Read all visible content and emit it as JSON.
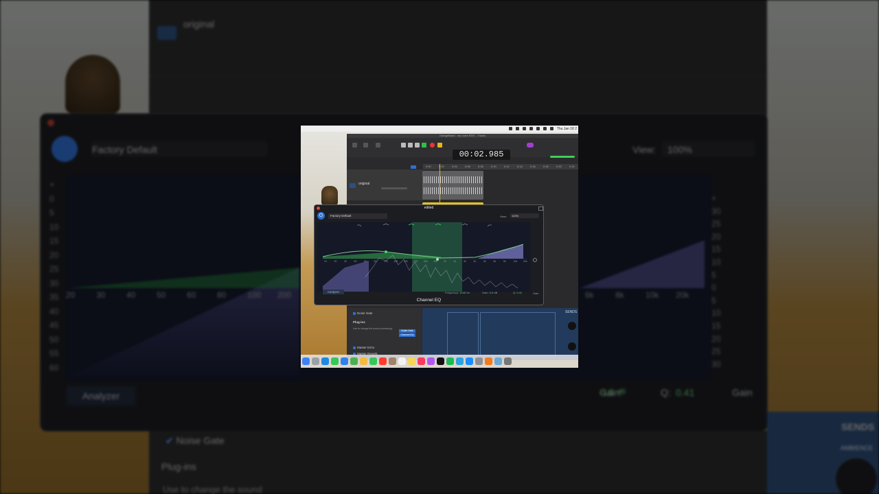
{
  "background": {
    "track_name": "original",
    "preset": "Factory Default",
    "view_label": "View:",
    "view_value": "100%",
    "analyzer": "Analyzer",
    "noise_gate": "Noise Gate",
    "plugins": "Plug-ins",
    "plugins_desc": "Use to change the sound",
    "sends": "SENDS",
    "ambience": "AMBIENCE",
    "gain_label": "Gain:",
    "gain_value": "0.0",
    "gain_unit": "dB",
    "q_label": "Q:",
    "q_value": "0.41",
    "gain_right": "Gain",
    "db_scale": [
      "+",
      "0",
      "5",
      "10",
      "15",
      "20",
      "25",
      "30",
      "35",
      "40",
      "45",
      "50",
      "55",
      "60"
    ],
    "db_scale_right": [
      "+",
      "30",
      "25",
      "20",
      "15",
      "10",
      "5",
      "0",
      "5",
      "10",
      "15",
      "20",
      "25",
      "30"
    ],
    "freq_left": [
      "20",
      "30",
      "40",
      "50",
      "60",
      "80",
      "100",
      "200"
    ],
    "freq_right": [
      "6k",
      "8k",
      "10k",
      "20k"
    ]
  },
  "window": {
    "title": "GarageBand - my voice EDIT - Tracks",
    "time": "00:02.985",
    "ruler": [
      "0:00",
      "0:02",
      "0:04",
      "0:06",
      "0:08",
      "0:10",
      "0:12",
      "0:14",
      "0:16",
      "0:18",
      "0:20",
      "0:22"
    ],
    "track_name": "original",
    "sends": "SENDS"
  },
  "eq": {
    "title": "edited",
    "preset": "Factory Default",
    "view_label": "View:",
    "view_value": "100%",
    "analyzer_button": "Analyzer",
    "frequency_label": "Frequency:",
    "frequency_value": "1040",
    "frequency_unit": "Hz",
    "gain_label": "Gain:",
    "gain_value": "0.0",
    "gain_unit": "dB",
    "q_label": "Q:",
    "q_value": "0.41",
    "gain_right": "Gain",
    "plugin_name": "Channel EQ",
    "freq_ticks": [
      "20",
      "30",
      "40",
      "50",
      "60",
      "80",
      "100",
      "200",
      "300",
      "400",
      "500",
      "800",
      "1k",
      "2k",
      "3k",
      "4k",
      "5k",
      "6k",
      "8k",
      "10k",
      "20k"
    ]
  },
  "library": {
    "noise_gate": "Noise Gate",
    "plugins": "Plug-ins",
    "plugins_desc": "Use to change the sound processing.",
    "plugin_slots": [
      "Noise Gate",
      "Channel EQ"
    ],
    "master_echo": "Master Echo",
    "master_reverb": "Master Reverb"
  },
  "menubar": {
    "clock": "Thu Jan 18 2"
  },
  "dock": {
    "icons": [
      "finder-icon",
      "launchpad-icon",
      "safari-icon",
      "messages-icon",
      "mail-icon",
      "maps-icon",
      "photos-icon",
      "facetime-icon",
      "calendar-icon",
      "contacts-icon",
      "reminders-icon",
      "notes-icon",
      "music-icon",
      "podcasts-icon",
      "tv-icon",
      "spotify-icon",
      "telegram-icon",
      "appstore-icon",
      "settings-icon",
      "garageband-icon",
      "preview-icon",
      "trash-icon"
    ],
    "colors": [
      "#3b82f6",
      "#9aa0a6",
      "#1e88e5",
      "#34c759",
      "#2f80ed",
      "#4caf50",
      "#f5b942",
      "#34c759",
      "#ff3b30",
      "#a0826d",
      "#f2f2f2",
      "#f7d358",
      "#ff375f",
      "#b157f0",
      "#111111",
      "#1db954",
      "#2aa3e0",
      "#1a8cff",
      "#8e8e93",
      "#f27a1f",
      "#6aa8d8",
      "#777777"
    ]
  }
}
